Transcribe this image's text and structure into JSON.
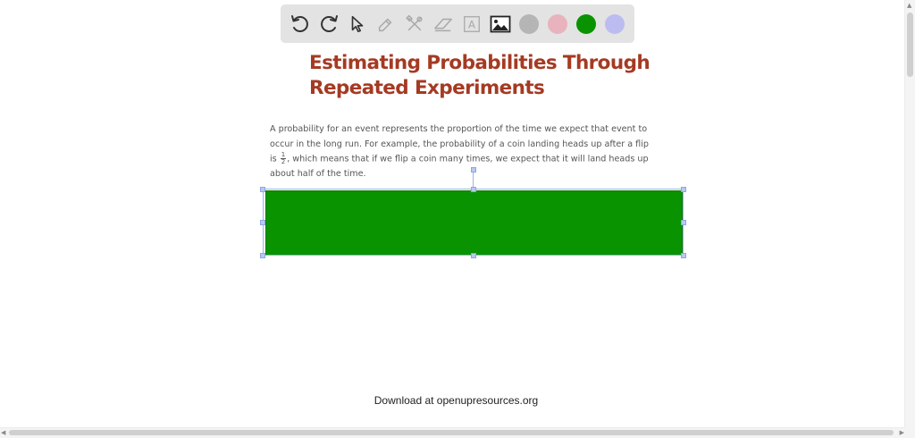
{
  "toolbar": {
    "tools": [
      {
        "name": "undo-icon"
      },
      {
        "name": "redo-icon"
      },
      {
        "name": "pointer-icon"
      },
      {
        "name": "pencil-icon"
      },
      {
        "name": "tools-icon"
      },
      {
        "name": "eraser-icon"
      },
      {
        "name": "text-icon",
        "glyph": "A"
      },
      {
        "name": "image-icon"
      }
    ],
    "colors": [
      "#b5b5b5",
      "#e8b3bc",
      "#0a9300",
      "#bcbcf0"
    ]
  },
  "document": {
    "title_line1": "Estimating Probabilities Through",
    "title_line2": "Repeated Experiments",
    "para_part1": "A probability for an event represents the proportion of the time we expect that event to occur in the long run. For example, the probability of a coin landing heads up after a flip is ",
    "frac_num": "1",
    "frac_den": "2",
    "para_part2": ", which means that if we flip a coin many times, we expect that it will land heads up about half of the time.",
    "shape_color": "#0a9300",
    "selection_color": "#9bb3ea"
  },
  "footer": {
    "text": "Download at openupresources.org"
  }
}
